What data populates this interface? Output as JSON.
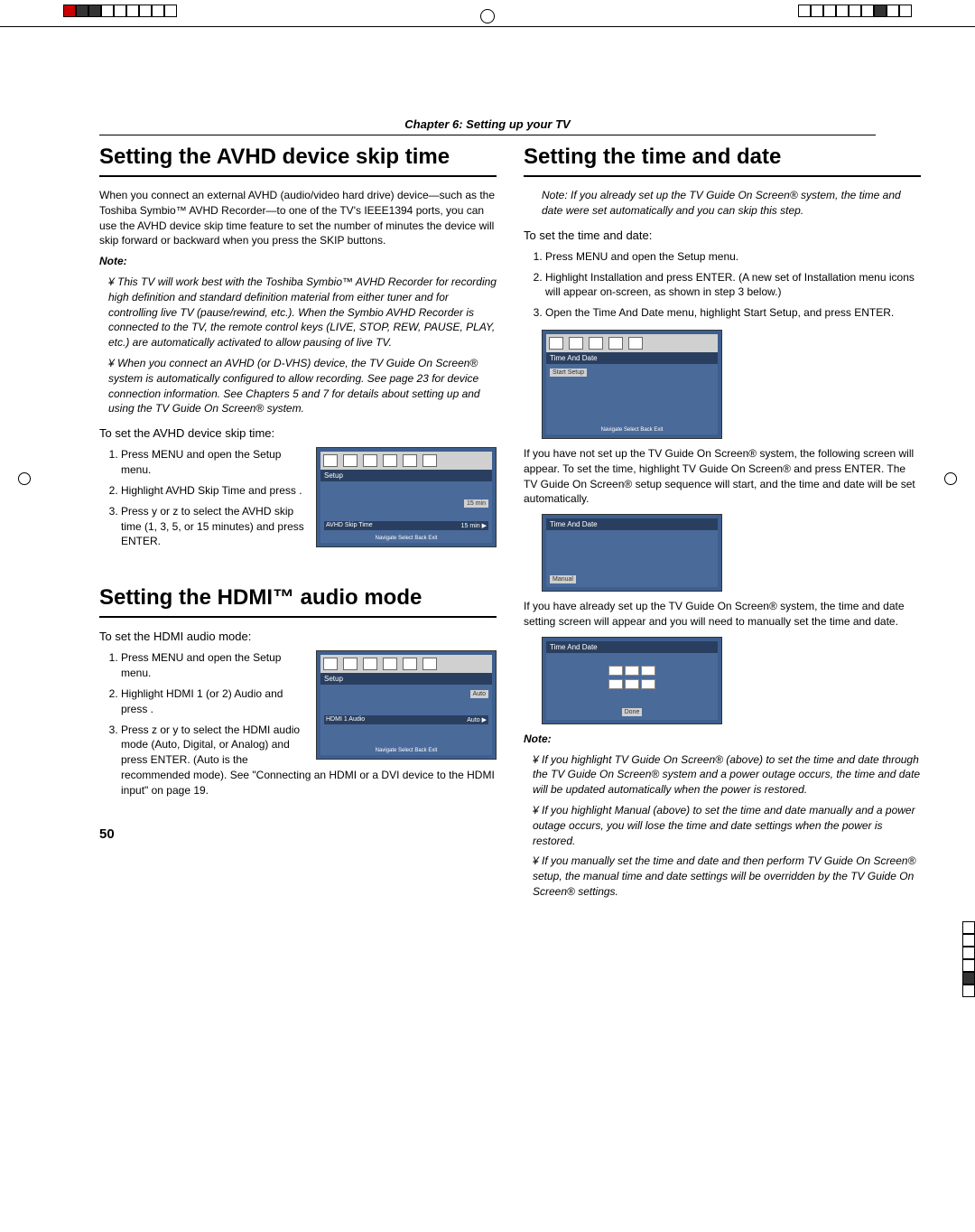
{
  "chapter": "Chapter 6: Setting up your TV",
  "page_number": "50",
  "left": {
    "h1_avhd": "Setting the AVHD device skip time",
    "avhd_intro": "When you connect an external AVHD (audio/video hard drive) device—such as the Toshiba Symbio™ AVHD Recorder—to one of the TV's IEEE1394 ports, you can use the AVHD device skip time feature to set the number of minutes the device will skip forward or backward when you press the SKIP buttons.",
    "note_label": "Note:",
    "note1": "This TV will work best with the Toshiba Symbio™ AVHD Recorder for recording high definition and standard definition material from either tuner and for controlling live TV (pause/rewind, etc.). When the Symbio AVHD Recorder is connected to the TV, the remote control keys (LIVE, STOP, REW, PAUSE, PLAY, etc.) are automatically activated to allow pausing of live TV.",
    "note2": "When you connect an AVHD (or D-VHS) device, the TV Guide On Screen® system is automatically configured to allow recording. See page 23 for device connection information. See Chapters 5 and 7 for details about setting up and using the TV Guide On Screen® system.",
    "avhd_to_set": "To set the AVHD device skip time:",
    "avhd_step1": "Press MENU and open the Setup menu.",
    "avhd_step2": "Highlight AVHD Skip Time and press .",
    "avhd_step3": "Press y or z to select the AVHD skip time (1, 3, 5, or 15 minutes) and press ENTER.",
    "h1_hdmi": "Setting the HDMI™ audio mode",
    "hdmi_to_set": "To set the HDMI audio mode:",
    "hdmi_step1": "Press MENU and open the Setup menu.",
    "hdmi_step2": "Highlight HDMI 1 (or 2) Audio and press .",
    "hdmi_step3": "Press z or y to select the HDMI audio mode (Auto, Digital, or Analog) and press ENTER. (Auto is the recommended mode). See \"Connecting an HDMI or a DVI device to the HDMI input\" on page 19.",
    "ui_avhd": {
      "title": "Setup",
      "row_label": "AVHD Skip Time",
      "row_value": "15 min ▶",
      "dropdown": "15 min",
      "footer": "Navigate    Select    Back    Exit"
    },
    "ui_hdmi": {
      "title": "Setup",
      "row_label": "HDMI 1 Audio",
      "row_value": "Auto ▶",
      "dropdown": "Auto",
      "footer": "Navigate    Select    Back    Exit"
    }
  },
  "right": {
    "h1_time": "Setting the time and date",
    "note_top": "Note: If you already set up the TV Guide On Screen® system, the time and date were set automatically and you can skip this step.",
    "to_set": "To set the time and date:",
    "step1": "Press MENU and open the Setup menu.",
    "step2": "Highlight Installation and press ENTER. (A new set of Installation menu icons will appear on-screen, as shown in step 3 below.)",
    "step3": "Open the Time And Date menu, highlight Start Setup, and press ENTER.",
    "ui1": {
      "title": "Time And Date",
      "btn": "Start Setup",
      "footer": "Navigate    Select    Back    Exit"
    },
    "para2": "If you have not set up the TV Guide On Screen® system, the following screen will appear. To set the time, highlight TV Guide On Screen® and press ENTER. The TV Guide On Screen® setup sequence will start, and the time and date will be set automatically.",
    "ui2": {
      "title": "Time And Date",
      "btn": "Manual"
    },
    "para3": "If you have already set up the TV Guide On Screen® system, the time and date setting screen will appear and you will need to manually set the time and date.",
    "ui3": {
      "title": "Time And Date",
      "btn": "Done"
    },
    "note_label": "Note:",
    "bnote1": "If you highlight TV Guide On Screen® (above) to set the time and date through the TV Guide On Screen® system and a power outage occurs, the time and date will be updated automatically when the power is restored.",
    "bnote2": "If you highlight Manual (above) to set the time and date manually and a power outage occurs, you will lose the time and date settings when the power is restored.",
    "bnote3": "If you manually set the time and date and then perform TV Guide On Screen® setup, the manual time and date settings will be overridden by the TV Guide On Screen® settings."
  }
}
